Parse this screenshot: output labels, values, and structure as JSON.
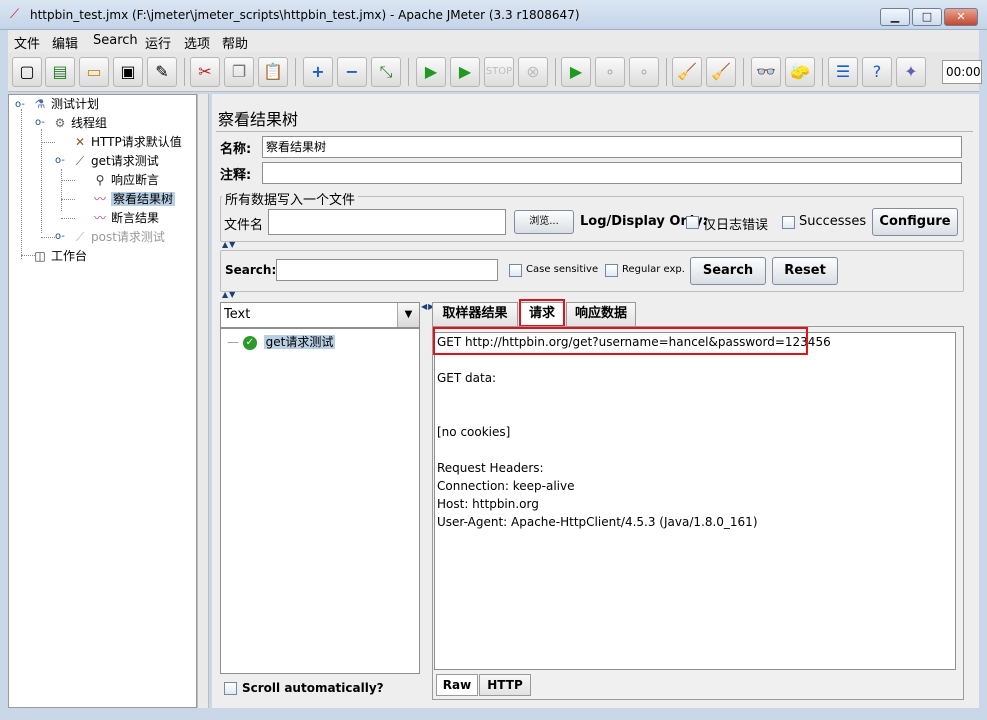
{
  "window": {
    "title": "httpbin_test.jmx (F:\\jmeter\\jmeter_scripts\\httpbin_test.jmx) - Apache JMeter (3.3 r1808647)",
    "minimize": "▁",
    "maximize": "□",
    "close": "✕"
  },
  "menu": [
    "文件",
    "编辑",
    "Search",
    "运行",
    "选项",
    "帮助"
  ],
  "toolbar": {
    "timer": "00:00:"
  },
  "tree": {
    "items": [
      {
        "label": "测试计划",
        "icon": "flask-icon"
      },
      {
        "label": "线程组",
        "icon": "gear-icon"
      },
      {
        "label": "HTTP请求默认值",
        "icon": "tools-icon"
      },
      {
        "label": "get请求测试",
        "icon": "pipette-icon"
      },
      {
        "label": "响应断言",
        "icon": "magnifier-icon"
      },
      {
        "label": "察看结果树",
        "icon": "graph-icon"
      },
      {
        "label": "断言结果",
        "icon": "graph-icon"
      },
      {
        "label": "post请求测试",
        "icon": "pipette-icon"
      },
      {
        "label": "工作台",
        "icon": "workbench-icon"
      }
    ]
  },
  "panel": {
    "title": "察看结果树",
    "name_label": "名称:",
    "name_value": "察看结果树",
    "comment_label": "注释:",
    "comment_value": "",
    "file_group_title": "所有数据写入一个文件",
    "filename_label": "文件名",
    "filename_value": "",
    "browse_button": "浏览...",
    "log_display_label": "Log/Display Only:",
    "errors_only_label": "仅日志错误",
    "successes_label": "Successes",
    "configure_button": "Configure"
  },
  "search": {
    "label": "Search:",
    "value": "",
    "case_sensitive": "Case sensitive",
    "regular_exp": "Regular exp.",
    "search_button": "Search",
    "reset_button": "Reset"
  },
  "results": {
    "renderer": "Text",
    "samples": [
      {
        "label": "get请求测试",
        "status": "success"
      }
    ],
    "scroll_auto": "Scroll automatically?"
  },
  "tabs": [
    "取样器结果",
    "请求",
    "响应数据"
  ],
  "active_tab": "请求",
  "request": {
    "lines": [
      "GET http://httpbin.org/get?username=hancel&password=123456",
      "",
      "GET data:",
      "",
      "",
      "[no cookies]",
      "",
      "Request Headers:",
      "Connection: keep-alive",
      "Host: httpbin.org",
      "User-Agent: Apache-HttpClient/4.5.3 (Java/1.8.0_161)"
    ]
  },
  "bottom_tabs": [
    "Raw",
    "HTTP"
  ],
  "colors": {
    "highlight": "#e0121b",
    "selection": "#b8cfe5"
  }
}
